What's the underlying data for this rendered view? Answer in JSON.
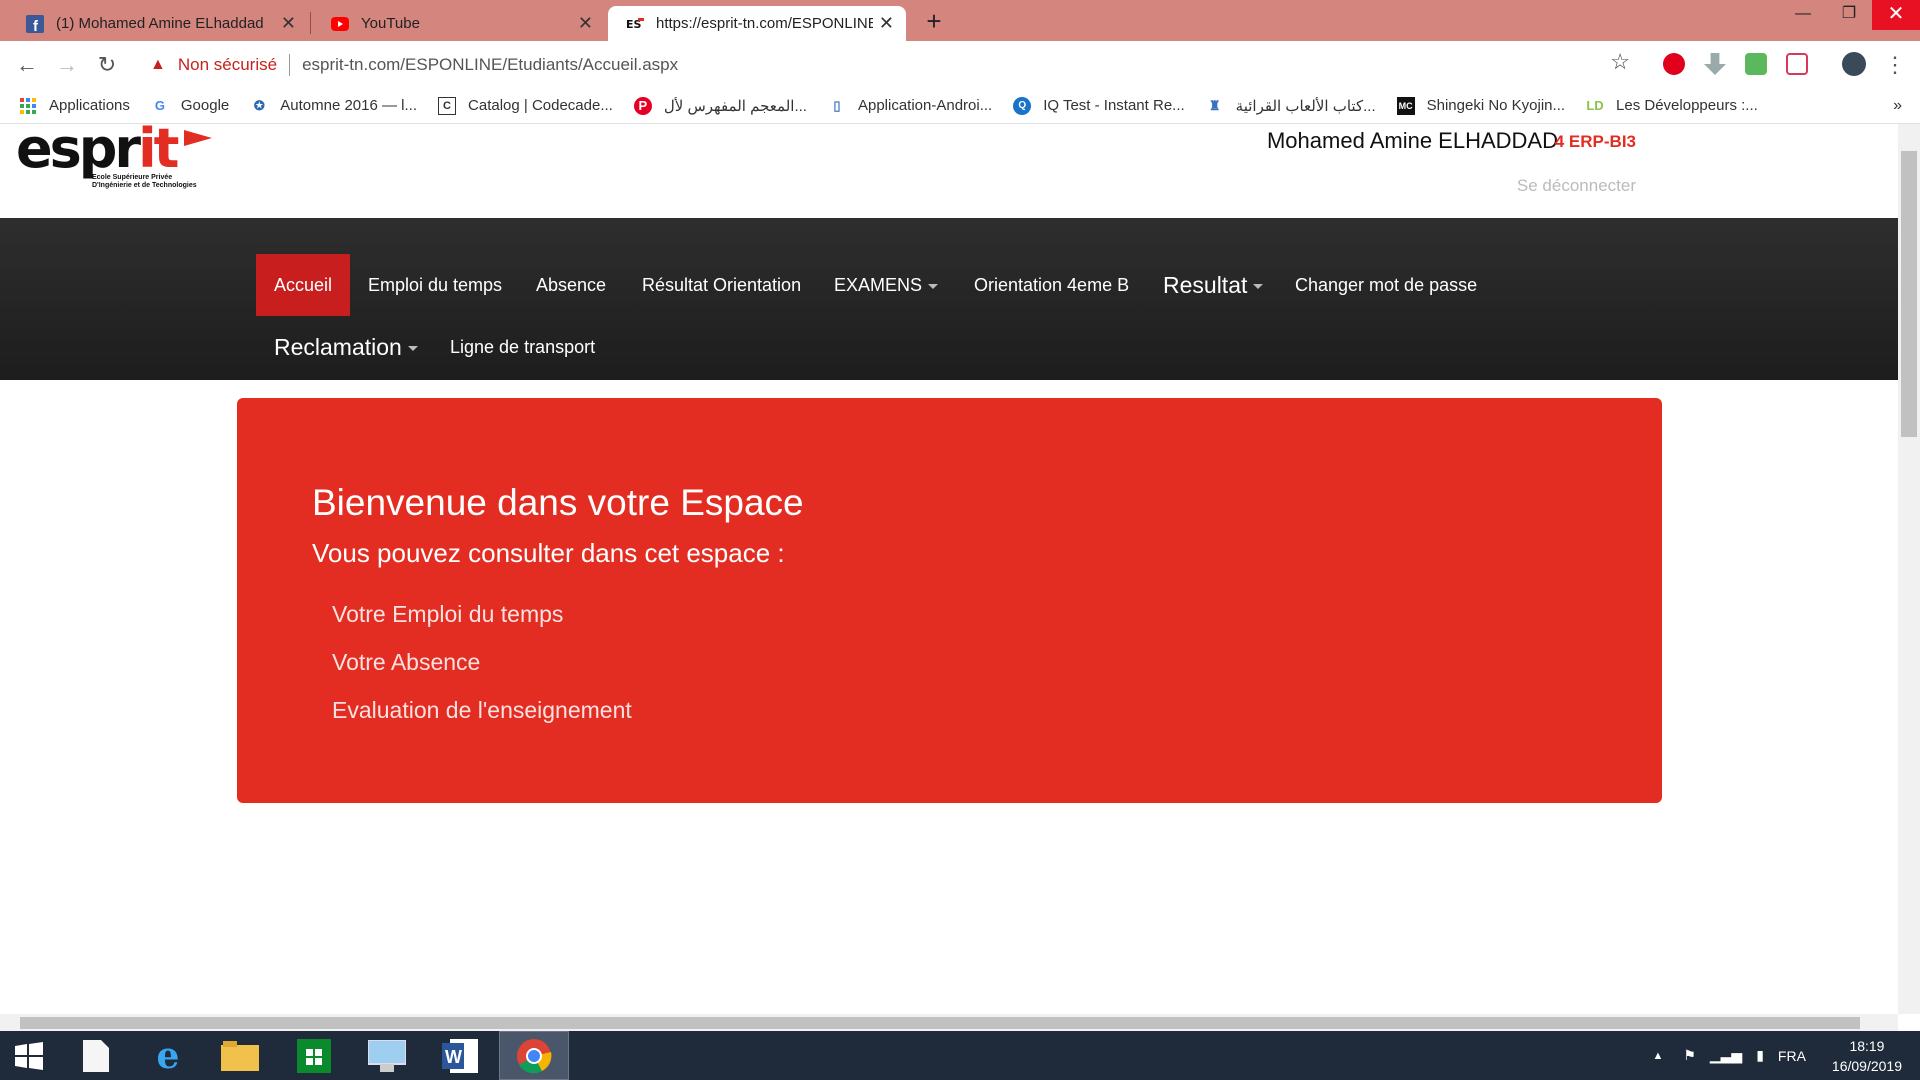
{
  "browser": {
    "tabs": [
      {
        "title": "(1) Mohamed Amine ELhaddad",
        "icon": "facebook-icon"
      },
      {
        "title": "YouTube",
        "icon": "youtube-icon"
      },
      {
        "title": "https://esprit-tn.com/ESPONLINE",
        "icon": "esprit-icon"
      }
    ],
    "security_label": "Non sécurisé",
    "url": "esprit-tn.com/ESPONLINE/Etudiants/Accueil.aspx",
    "bookmarks": [
      {
        "label": "Applications",
        "icon": "apps-grid-icon"
      },
      {
        "label": "Google",
        "icon": "google-icon"
      },
      {
        "label": "Automne 2016 — l...",
        "icon": "globe-icon"
      },
      {
        "label": "Catalog | Codecade...",
        "icon": "codecademy-icon"
      },
      {
        "label": "المعجم المفهرس لأل...",
        "icon": "pinterest-icon"
      },
      {
        "label": "Application-Androi...",
        "icon": "file-icon"
      },
      {
        "label": "IQ Test - Instant Re...",
        "icon": "iq-icon"
      },
      {
        "label": "كتاب الألعاب القرائية...",
        "icon": "book-icon"
      },
      {
        "label": "Shingeki No Kyojin...",
        "icon": "mc-icon"
      },
      {
        "label": "Les Développeurs :...",
        "icon": "ld-icon"
      }
    ],
    "more_bookmarks": "»"
  },
  "header": {
    "logo_main": "espr",
    "logo_accent": "it",
    "logo_sub1": "Ecole Supérieure Privée",
    "logo_sub2": "D'Ingénierie et de Technologies",
    "user_name": "Mohamed Amine ELHADDAD",
    "user_class": "4 ERP-BI3",
    "logout": "Se déconnecter"
  },
  "nav": {
    "items": [
      "Accueil",
      "Emploi du temps",
      "Absence",
      "Résultat Orientation",
      "EXAMENS",
      "Orientation 4eme B",
      "Resultat",
      "Changer mot de passe",
      "Reclamation",
      "Ligne de transport"
    ]
  },
  "welcome": {
    "title": "Bienvenue dans votre Espace",
    "subtitle": "Vous pouvez consulter dans cet espace :",
    "items": [
      "Votre Emploi du temps",
      "Votre Absence",
      "Evaluation de l'enseignement"
    ]
  },
  "taskbar": {
    "language": "FRA",
    "time": "18:19",
    "date": "16/09/2019"
  },
  "colors": {
    "accent": "#e32d22",
    "nav_active": "#c91e1e",
    "navbar": "#262626"
  }
}
